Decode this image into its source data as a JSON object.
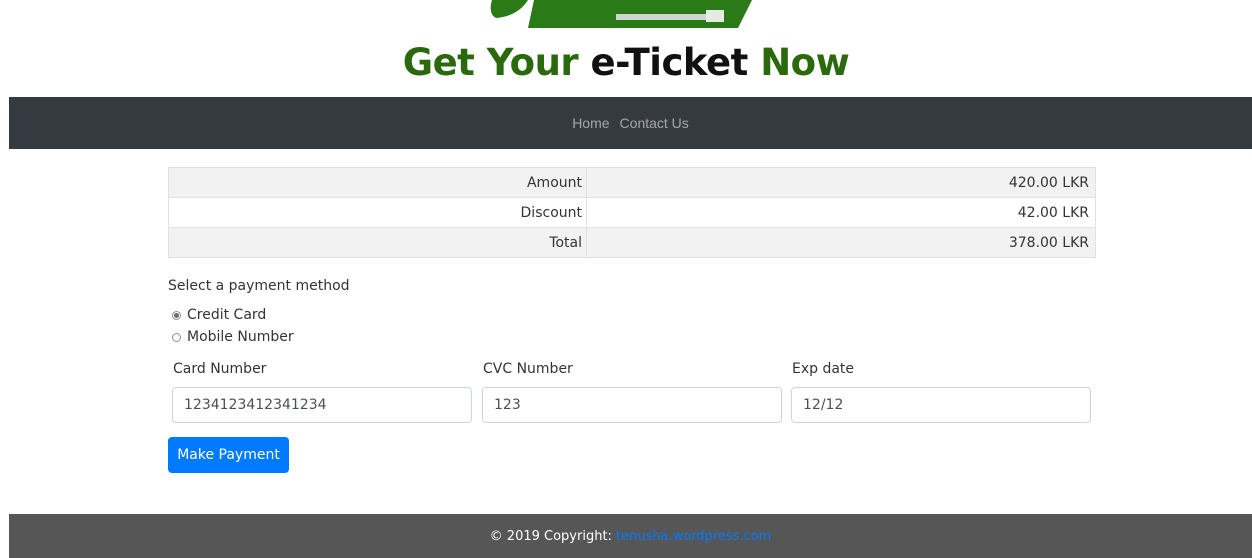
{
  "header": {
    "title_parts": [
      "Get Your",
      "e-Ticket",
      "Now"
    ]
  },
  "nav": {
    "items": [
      "Home",
      "Contact Us"
    ]
  },
  "summary": {
    "rows": [
      {
        "label": "Amount",
        "value": "420.00 LKR"
      },
      {
        "label": "Discount",
        "value": "42.00 LKR"
      },
      {
        "label": "Total",
        "value": "378.00 LKR"
      }
    ]
  },
  "payment": {
    "prompt": "Select a payment method",
    "options": [
      {
        "label": "Credit Card",
        "selected": true
      },
      {
        "label": "Mobile Number",
        "selected": false
      }
    ]
  },
  "card": {
    "number_label": "Card Number",
    "number_value": "1234123412341234",
    "cvc_label": "CVC Number",
    "cvc_value": "123",
    "exp_label": "Exp date",
    "exp_value": "12/12"
  },
  "actions": {
    "submit_label": "Make Payment"
  },
  "footer": {
    "copyright": "© 2019 Copyright:",
    "link": "tenusha.wordpress.com"
  },
  "colors": {
    "brand_green": "#2a6a0c",
    "navbar_bg": "#343a40",
    "primary": "#007bff",
    "footer_bg": "#565656"
  }
}
